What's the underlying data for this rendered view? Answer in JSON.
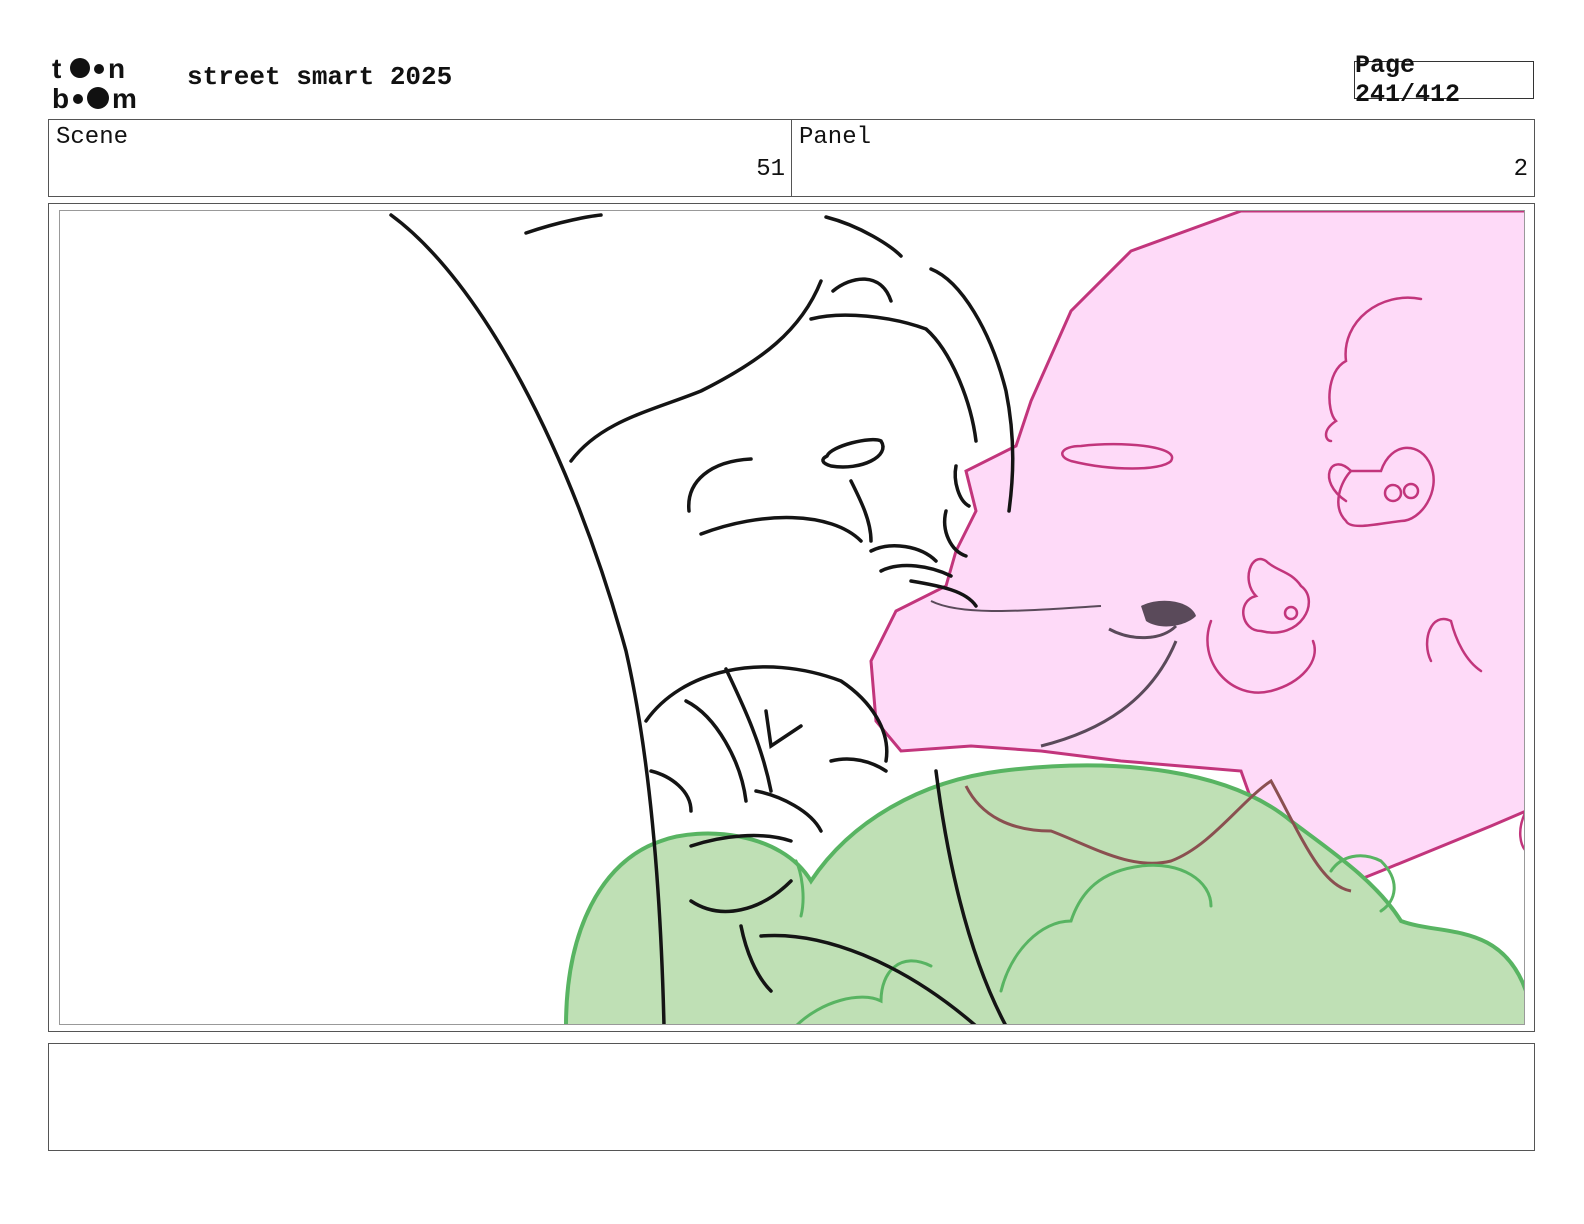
{
  "header": {
    "logo_text_top": "toon",
    "logo_text_bottom": "boom",
    "project_title": "street smart 2025",
    "page_label": "Page 241/412"
  },
  "info": {
    "scene_label": "Scene",
    "scene_value": "51",
    "panel_label": "Panel",
    "panel_value": "2"
  },
  "notes": {
    "text": ""
  },
  "colors": {
    "pink_fill": "#fedaf8",
    "pink_stroke": "#c2357c",
    "green_fill": "#bfe0b5",
    "green_stroke": "#58b462",
    "ink": "#141414"
  }
}
